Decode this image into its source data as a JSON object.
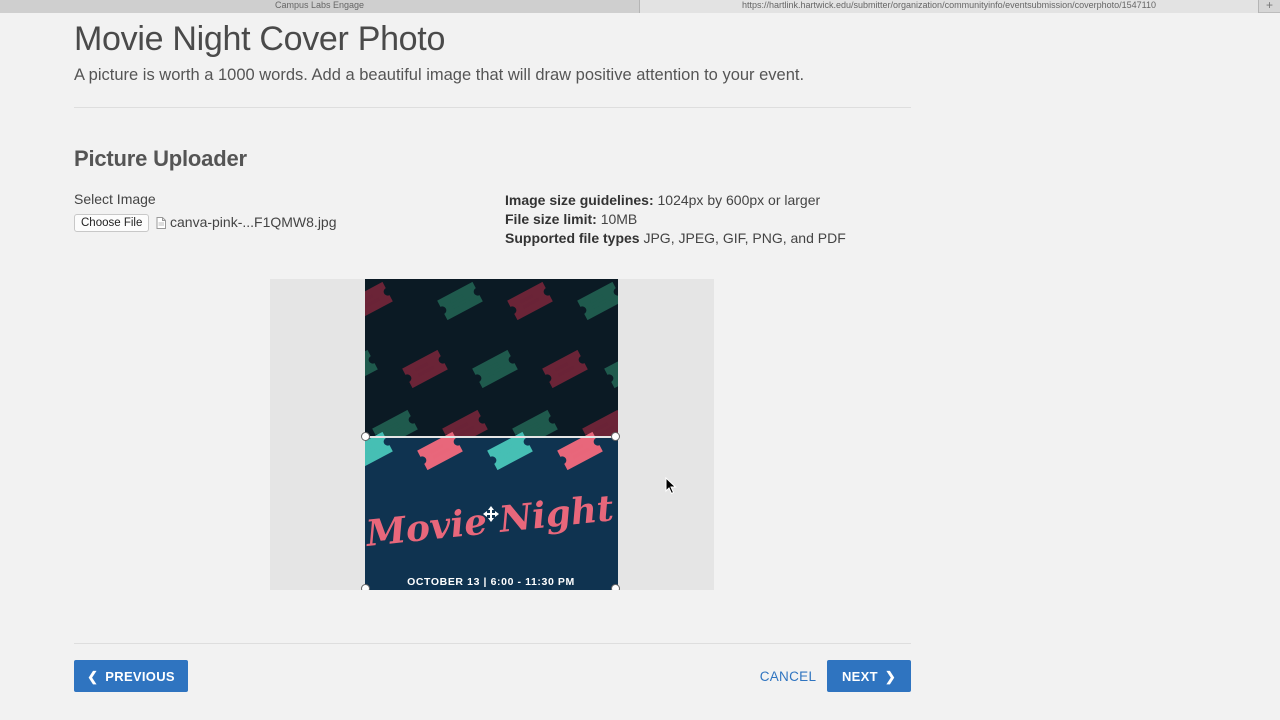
{
  "browser": {
    "tabs": [
      {
        "label": "Campus Labs Engage"
      },
      {
        "label": "https://hartlink.hartwick.edu/submitter/organization/communityinfo/eventsubmission/coverphoto/1547110"
      }
    ],
    "new_tab_glyph": "+"
  },
  "header": {
    "title": "Movie Night Cover Photo",
    "subtitle": "A picture is worth a 1000 words. Add a beautiful image that will draw positive attention to your event."
  },
  "uploader": {
    "section_title": "Picture Uploader",
    "select_label": "Select Image",
    "choose_file_label": "Choose File",
    "file_name": "canva-pink-...F1QMW8.jpg",
    "guidelines": [
      {
        "label": "Image size guidelines:",
        "value": " 1024px by 600px or larger"
      },
      {
        "label": "File size limit:",
        "value": " 10MB"
      },
      {
        "label": "Supported file types",
        "value": " JPG, JPEG, GIF, PNG, and PDF"
      }
    ]
  },
  "poster": {
    "title": "Movie Night",
    "date_line": "OCTOBER 13 | 6:00 - 11:30 PM",
    "colors": {
      "dark": "#0b1a24",
      "navy": "#0f3350",
      "pink": "#e8677b",
      "teal": "#46bfb4",
      "maroon": "#6b2437",
      "green": "#1f5a4d"
    }
  },
  "footer": {
    "previous_label": "PREVIOUS",
    "cancel_label": "CANCEL",
    "next_label": "NEXT"
  },
  "theme": {
    "primary": "#2f74c0"
  }
}
